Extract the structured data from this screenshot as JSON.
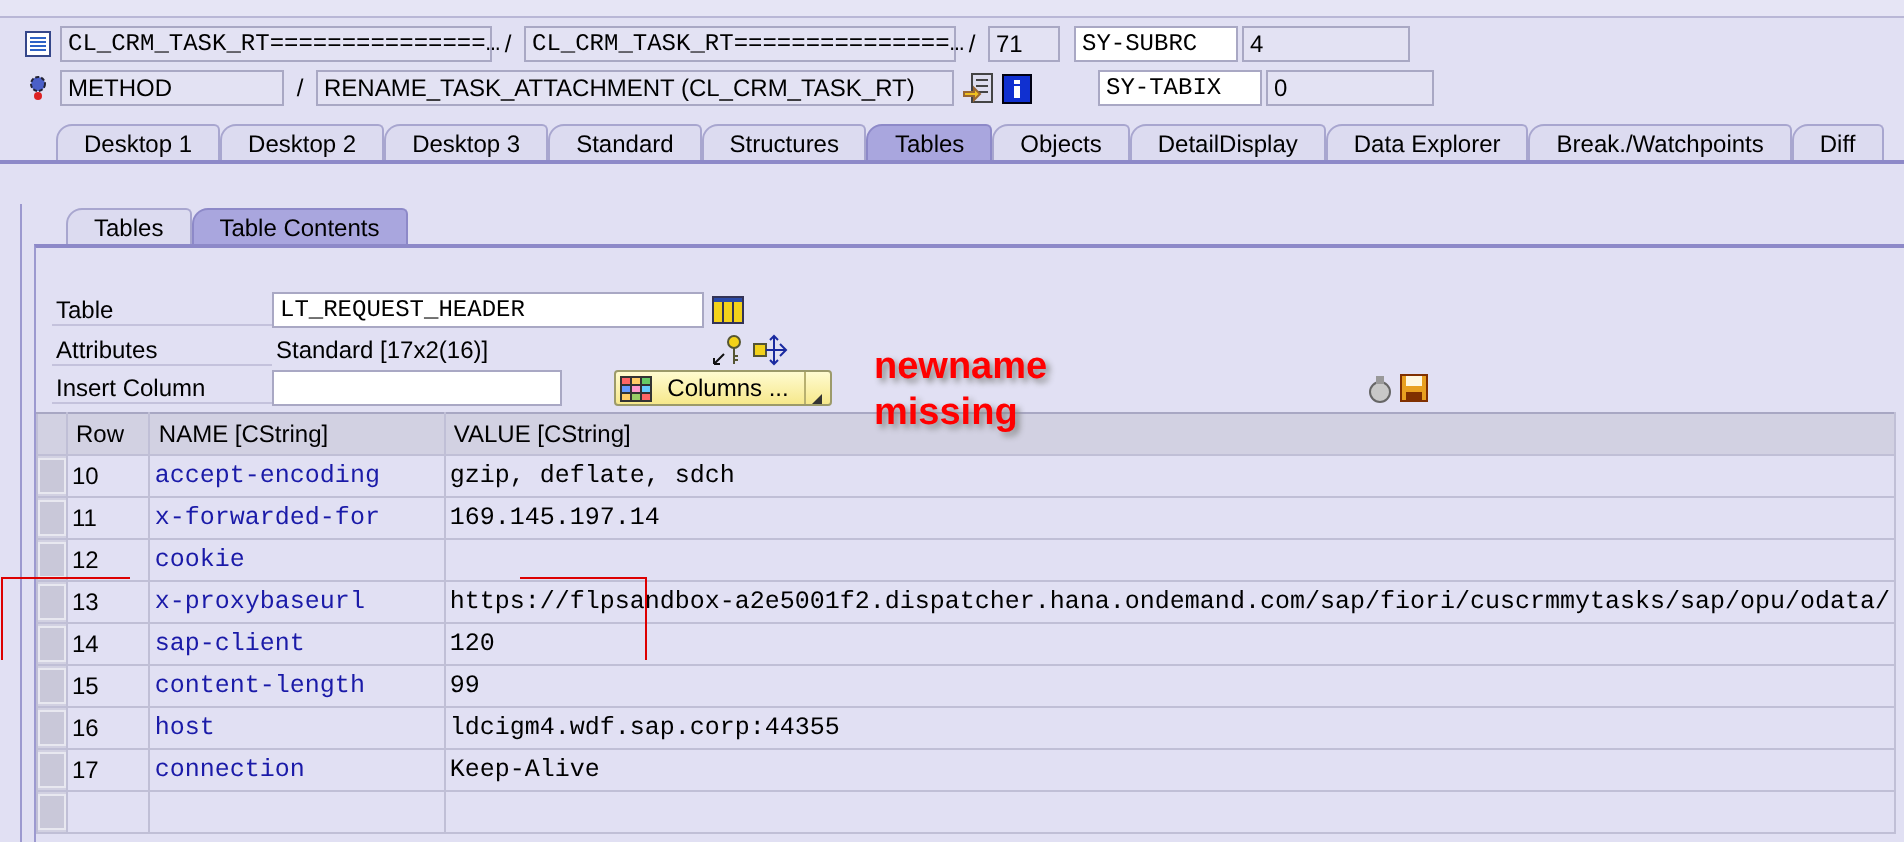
{
  "header": {
    "program": "CL_CRM_TASK_RT===============…",
    "include": "CL_CRM_TASK_RT===============…",
    "line": "71",
    "event_type": "METHOD",
    "event": "RENAME_TASK_ATTACHMENT (CL_CRM_TASK_RT)",
    "separator": "/",
    "variables": [
      {
        "name": "SY-SUBRC",
        "value": "4"
      },
      {
        "name": "SY-TABIX",
        "value": "0"
      }
    ]
  },
  "tabs": [
    {
      "label": "Desktop 1",
      "selected": false
    },
    {
      "label": "Desktop 2",
      "selected": false
    },
    {
      "label": "Desktop 3",
      "selected": false
    },
    {
      "label": "Standard",
      "selected": false
    },
    {
      "label": "Structures",
      "selected": false
    },
    {
      "label": "Tables",
      "selected": true
    },
    {
      "label": "Objects",
      "selected": false
    },
    {
      "label": "DetailDisplay",
      "selected": false
    },
    {
      "label": "Data Explorer",
      "selected": false
    },
    {
      "label": "Break./Watchpoints",
      "selected": false
    },
    {
      "label": "Diff",
      "selected": false
    }
  ],
  "subtabs": [
    {
      "label": "Tables",
      "selected": false
    },
    {
      "label": "Table Contents",
      "selected": true
    }
  ],
  "form": {
    "table_label": "Table",
    "table_value": "LT_REQUEST_HEADER",
    "attributes_label": "Attributes",
    "attributes_value": "Standard [17x2(16)]",
    "insert_label": "Insert Column",
    "columns_button": "Columns ..."
  },
  "annotation": [
    "newname",
    "missing"
  ],
  "table": {
    "columns": [
      "Row",
      "NAME [CString]",
      "VALUE [CString]"
    ],
    "rows": [
      {
        "row": "10",
        "name": "accept-encoding",
        "value": "gzip, deflate, sdch"
      },
      {
        "row": "11",
        "name": "x-forwarded-for",
        "value": "169.145.197.14"
      },
      {
        "row": "12",
        "name": "cookie"
      },
      {
        "row": "13",
        "name": "x-proxybaseurl",
        "value": "https://flpsandbox-a2e5001f2.dispatcher.hana.ondemand.com/sap/fiori/cuscrmmytasks/sap/opu/odata/"
      },
      {
        "row": "14",
        "name": "sap-client",
        "value": "120"
      },
      {
        "row": "15",
        "name": "content-length",
        "value": "99"
      },
      {
        "row": "16",
        "name": "host",
        "value": "ldcigm4.wdf.sap.corp:44355"
      },
      {
        "row": "17",
        "name": "connection",
        "value": "Keep-Alive"
      }
    ]
  }
}
